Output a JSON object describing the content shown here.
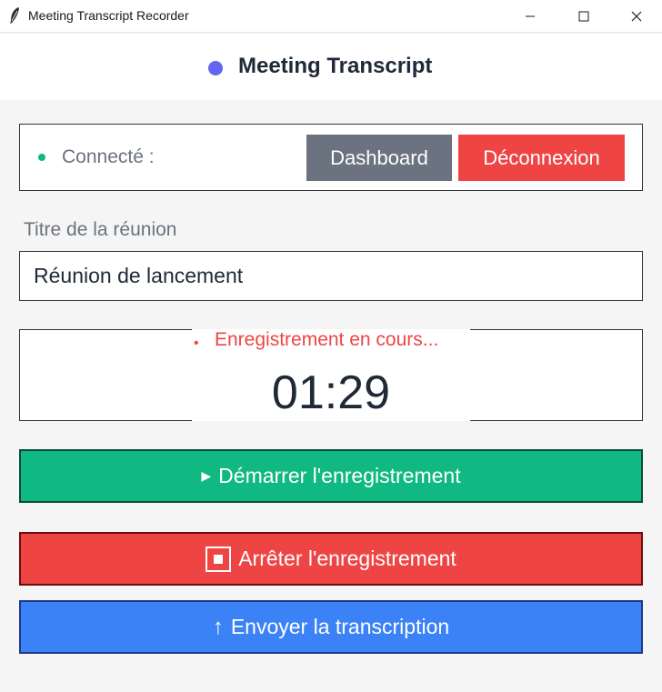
{
  "window": {
    "title": "Meeting Transcript Recorder"
  },
  "header": {
    "title": "Meeting Transcript",
    "dot_color": "#6366f1"
  },
  "connection": {
    "status_label": "Connecté :",
    "status_color": "#10b981",
    "dashboard_label": "Dashboard",
    "logout_label": "Déconnexion"
  },
  "meeting": {
    "title_label": "Titre de la réunion",
    "title_value": "Réunion de lancement"
  },
  "recording": {
    "status_text": "Enregistrement en cours...",
    "timer": "01:29"
  },
  "actions": {
    "start_label": "Démarrer l'enregistrement",
    "stop_label": "Arrêter l'enregistrement",
    "send_label": "Envoyer la transcription",
    "start_icon": "play-icon",
    "stop_icon": "stop-icon",
    "send_icon": "upload-arrow-icon"
  },
  "colors": {
    "start": "#10b981",
    "stop": "#ef4444",
    "send": "#3b82f6",
    "dashboard": "#6b7280"
  }
}
